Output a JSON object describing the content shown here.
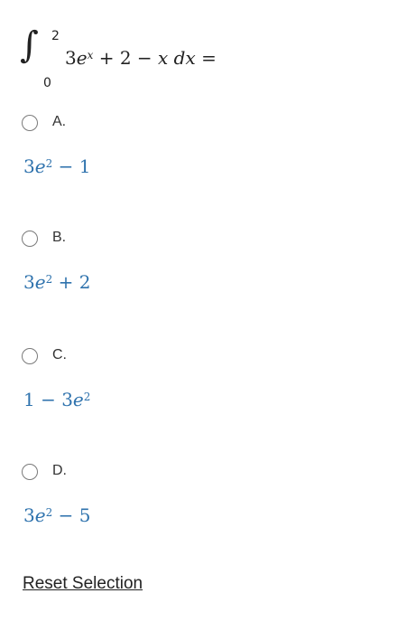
{
  "question": {
    "integral_sign": "∫",
    "upper_limit": "2",
    "lower_limit": "0",
    "integrand": {
      "coef": "3",
      "base": "e",
      "exponent": "x",
      "rest": " + 2 − ",
      "var": "x",
      "dx": " dx",
      "equals": " ="
    }
  },
  "options": [
    {
      "letter": "A.",
      "answer": {
        "pre": "3",
        "base": "e",
        "exp": "2",
        "post": " − 1"
      }
    },
    {
      "letter": "B.",
      "answer": {
        "pre": "3",
        "base": "e",
        "exp": "2",
        "post": " + 2"
      }
    },
    {
      "letter": "C.",
      "answer": {
        "pre": "1 − 3",
        "base": "e",
        "exp": "2",
        "post": ""
      }
    },
    {
      "letter": "D.",
      "answer": {
        "pre": "3",
        "base": "e",
        "exp": "2",
        "post": " − 5"
      }
    }
  ],
  "reset_label": "Reset Selection"
}
